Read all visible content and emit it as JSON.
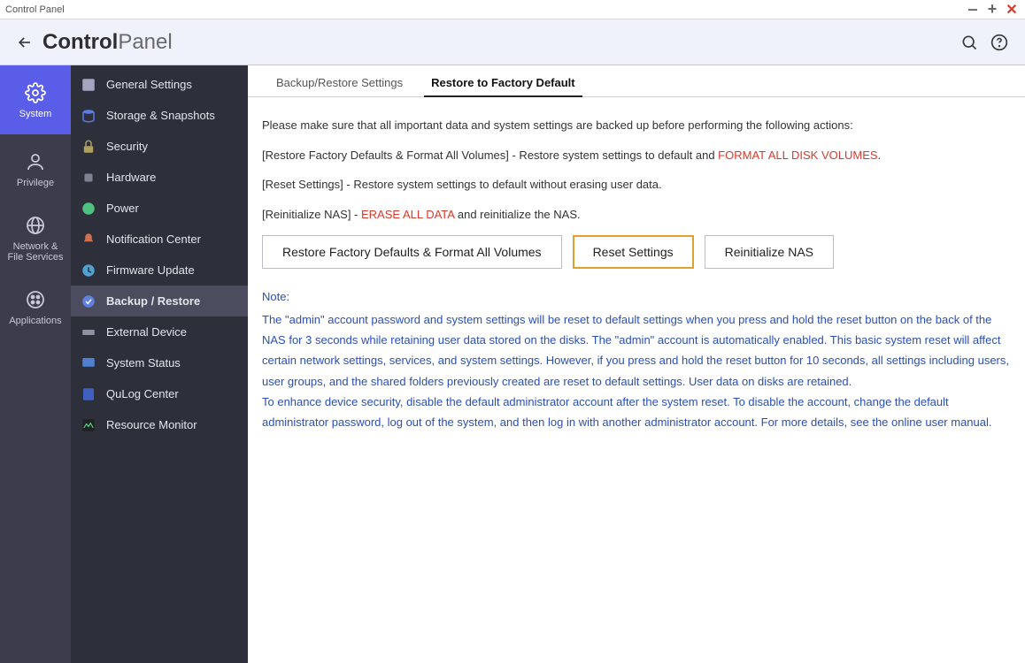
{
  "window": {
    "title": "Control Panel"
  },
  "header": {
    "title_bold": "Control",
    "title_light": "Panel"
  },
  "rail": [
    {
      "label": "System"
    },
    {
      "label": "Privilege"
    },
    {
      "label": "Network &\nFile Services"
    },
    {
      "label": "Applications"
    }
  ],
  "sidebar": [
    {
      "label": "General Settings"
    },
    {
      "label": "Storage & Snapshots"
    },
    {
      "label": "Security"
    },
    {
      "label": "Hardware"
    },
    {
      "label": "Power"
    },
    {
      "label": "Notification Center"
    },
    {
      "label": "Firmware Update"
    },
    {
      "label": "Backup / Restore"
    },
    {
      "label": "External Device"
    },
    {
      "label": "System Status"
    },
    {
      "label": "QuLog Center"
    },
    {
      "label": "Resource Monitor"
    }
  ],
  "tabs": [
    {
      "label": "Backup/Restore Settings"
    },
    {
      "label": "Restore to Factory Default"
    }
  ],
  "content": {
    "intro": "Please make sure that all important data and system settings are backed up before performing the following actions:",
    "line1_a": "[Restore Factory Defaults & Format All Volumes] - Restore system settings to default and ",
    "line1_b": "FORMAT ALL DISK VOLUMES",
    "line1_c": ".",
    "line2": "[Reset Settings] - Restore system settings to default without erasing user data.",
    "line3_a": "[Reinitialize NAS] - ",
    "line3_b": "ERASE ALL DATA",
    "line3_c": " and reinitialize the NAS.",
    "buttons": {
      "restore": "Restore Factory Defaults & Format All Volumes",
      "reset": "Reset Settings",
      "reinit": "Reinitialize NAS"
    },
    "note_title": "Note:",
    "note_p1": "The \"admin\" account password and system settings will be reset to default settings when you press and hold the reset button on the back of the NAS for 3 seconds while retaining user data stored on the disks. The \"admin\" account is automatically enabled. This basic system reset will affect certain network settings, services, and system settings. However, if you press and hold the reset button for 10 seconds, all settings including users, user groups, and the shared folders previously created are reset to default settings. User data on disks are retained.",
    "note_p2": "To enhance device security, disable the default administrator account after the system reset. To disable the account, change the default administrator password, log out of the system, and then log in with another administrator account. For more details, see the online user manual."
  }
}
